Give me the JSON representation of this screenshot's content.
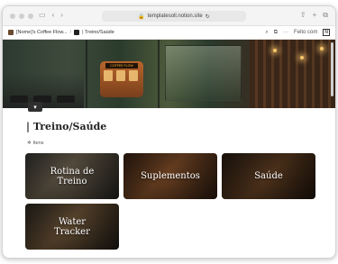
{
  "browser": {
    "url": "templatesoll.notion.site",
    "nav_back_icon": "chevron-left-icon",
    "nav_forward_icon": "chevron-right-icon"
  },
  "topbar": {
    "crumb1": "[Nome]'s Coffee Flow...",
    "crumb2": "| Treino/Saúde",
    "made_with": "Feito com",
    "notion_mark": "N"
  },
  "cover": {
    "bus_sign": "COFFEE FLOW"
  },
  "page": {
    "title": "| Treino/Saúde",
    "views_label": "Itens"
  },
  "cards": [
    {
      "title": "Rotina de Treino"
    },
    {
      "title": "Suplementos"
    },
    {
      "title": "Saúde"
    },
    {
      "title": "Water Tracker"
    }
  ],
  "colors": {
    "accent": "#222222",
    "cover_wood": "#5a3a22"
  }
}
